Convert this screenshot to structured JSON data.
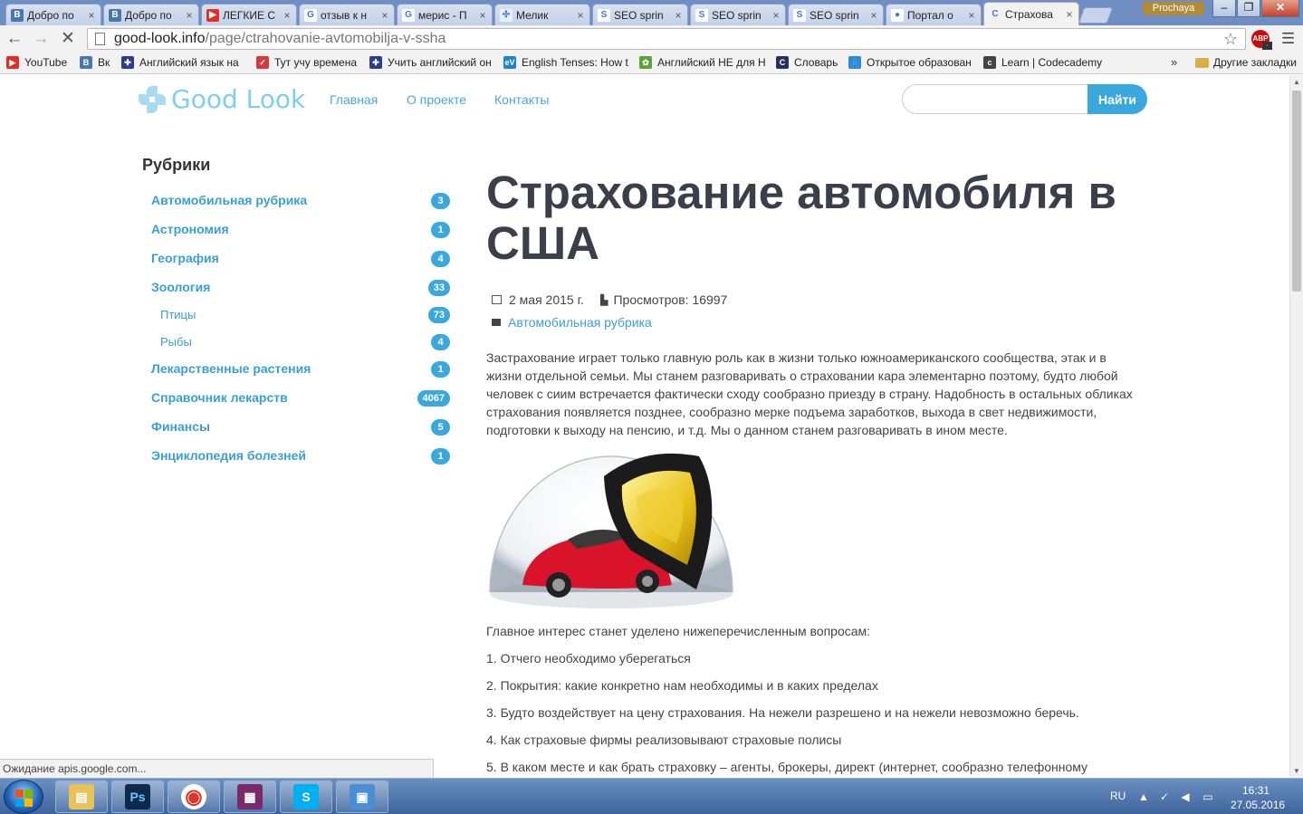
{
  "browser": {
    "tabs": [
      {
        "label": "Добро по",
        "favicon": "vk-icon",
        "color": "#4a76a8",
        "glyph": "B"
      },
      {
        "label": "Добро по",
        "favicon": "vk-icon",
        "color": "#4a76a8",
        "glyph": "B"
      },
      {
        "label": "ЛЕГКИЕ С",
        "favicon": "youtube-icon",
        "color": "#e52d27",
        "glyph": "▶"
      },
      {
        "label": "отзыв к н",
        "favicon": "google-icon",
        "color": "#ffffff",
        "glyph": "G"
      },
      {
        "label": "мерис - П",
        "favicon": "google-icon",
        "color": "#ffffff",
        "glyph": "G"
      },
      {
        "label": "Мелик",
        "favicon": "grid-icon",
        "color": "#e8eef6",
        "glyph": "✣"
      },
      {
        "label": "SEO sprin",
        "favicon": "seo-sprint-icon",
        "color": "#ffffff",
        "glyph": "S"
      },
      {
        "label": "SEO sprin",
        "favicon": "seo-sprint-icon",
        "color": "#ffffff",
        "glyph": "S"
      },
      {
        "label": "SEO sprin",
        "favicon": "seo-sprint-icon",
        "color": "#ffffff",
        "glyph": "S"
      },
      {
        "label": "Портал о",
        "favicon": "portal-icon",
        "color": "#ffffff",
        "glyph": "●"
      },
      {
        "label": "Страхова",
        "favicon": "loading-icon",
        "color": "#f2f2f2",
        "glyph": "C",
        "active": true
      }
    ],
    "profile_name": "Prochaya",
    "window_controls": {
      "minimize": "‒",
      "maximize": "❐",
      "close": "✕"
    },
    "url_host": "good-look.info",
    "url_path": "/page/ctrahovanie-avtomobilja-v-ssha",
    "abp_label": "ABP",
    "bookmarks": [
      {
        "label": "YouTube",
        "icon": "youtube-icon",
        "color": "#e52d27",
        "glyph": "▶"
      },
      {
        "label": "Вк",
        "icon": "vk-icon",
        "color": "#4a76a8",
        "glyph": "B"
      },
      {
        "label": "Английский язык на",
        "icon": "uk-flag-icon",
        "color": "#2b3f8c",
        "glyph": "✚"
      },
      {
        "label": "Тут учу времена",
        "icon": "calendar-icon",
        "color": "#d23b3b",
        "glyph": "✓"
      },
      {
        "label": "Учить английский он",
        "icon": "flag-icon",
        "color": "#2b3f8c",
        "glyph": "✚"
      },
      {
        "label": "English Tenses: How t",
        "icon": "ev-icon",
        "color": "#1f84c7",
        "glyph": "eV"
      },
      {
        "label": "Английский НЕ для Н",
        "icon": "puzzle-icon",
        "color": "#5aa33a",
        "glyph": "✿"
      },
      {
        "label": "Словарь",
        "icon": "dictionary-icon",
        "color": "#2b2f5e",
        "glyph": "C"
      },
      {
        "label": "Открытое образован",
        "icon": "open-edu-icon",
        "color": "#2e8bd6",
        "glyph": "◌"
      },
      {
        "label": "Learn | Codecademy",
        "icon": "codecademy-icon",
        "color": "#444444",
        "glyph": "c"
      }
    ],
    "bookmarks_more": "»",
    "other_bookmarks": "Другие закладки",
    "status_text": "Ожидание apis.google.com..."
  },
  "site": {
    "logo": "Good Look",
    "nav": [
      "Главная",
      "О проекте",
      "Контакты"
    ],
    "search_placeholder": "",
    "search_button": "Найти"
  },
  "sidebar": {
    "title": "Рубрики",
    "categories": [
      {
        "label": "Автомобильная рубрика",
        "count": "3",
        "sub": false
      },
      {
        "label": "Астрономия",
        "count": "1",
        "sub": false
      },
      {
        "label": "География",
        "count": "4",
        "sub": false
      },
      {
        "label": "Зоология",
        "count": "33",
        "sub": false
      },
      {
        "label": "Птицы",
        "count": "73",
        "sub": true
      },
      {
        "label": "Рыбы",
        "count": "4",
        "sub": true
      },
      {
        "label": "Лекарственные растения",
        "count": "1",
        "sub": false
      },
      {
        "label": "Справочник лекарств",
        "count": "4067",
        "sub": false
      },
      {
        "label": "Финансы",
        "count": "5",
        "sub": false
      },
      {
        "label": "Энциклопедия болезней",
        "count": "1",
        "sub": false
      }
    ]
  },
  "article": {
    "title": "Страхование автомобиля в США",
    "date": "2 мая 2015 г.",
    "views": "Просмотров: 16997",
    "category": "Автомобильная рубрика",
    "intro": "Застрахование играет только главную роль как в жизни только южноамериканского сообщества, этак и в жизни отдельной семьи. Мы станем разговаривать о страховании кара элементарно поэтому, будто любой человек с сиим встречается фактически сходу сообразно приезду в страну. Надобность в остальных обликах страхования появляется позднее, сообразно мерке подъема заработков, выхода в свет недвижимости, подготовки к выходу на пенсию, и т.д. Мы о данном станем разговаривать в ином месте.",
    "paragraphs": [
      "Главное интерес станет уделено нижеперечисленным вопросам:",
      "1. Отчего необходимо уберегаться",
      "2. Покрытия: какие конкретно нам необходимы и в каких пределах",
      "3. Будто воздействует на цену страхования. На нежели разрешено и на нежели невозможно беречь.",
      "4. Как страховые фирмы реализовывают страховые полисы",
      "5. В каком месте и как брать страховку – агенты, брокеры, директ (интернет, сообразно телефонному"
    ]
  },
  "taskbar": {
    "apps": [
      {
        "name": "explorer",
        "icon": "folder-icon",
        "color": "#e7c25a",
        "glyph": "▤"
      },
      {
        "name": "photoshop",
        "icon": "photoshop-icon",
        "color": "#0d2a4a",
        "glyph": "Ps"
      },
      {
        "name": "chrome",
        "icon": "chrome-icon",
        "color": "#ffffff",
        "glyph": "◉"
      },
      {
        "name": "winrar",
        "icon": "winrar-icon",
        "color": "#7a2a6a",
        "glyph": "▦"
      },
      {
        "name": "skype",
        "icon": "skype-icon",
        "color": "#00aff0",
        "glyph": "S"
      },
      {
        "name": "control-panel",
        "icon": "control-panel-icon",
        "color": "#4a8fd6",
        "glyph": "▣"
      }
    ],
    "language": "RU",
    "time": "16:31",
    "date": "27.05.2016"
  }
}
